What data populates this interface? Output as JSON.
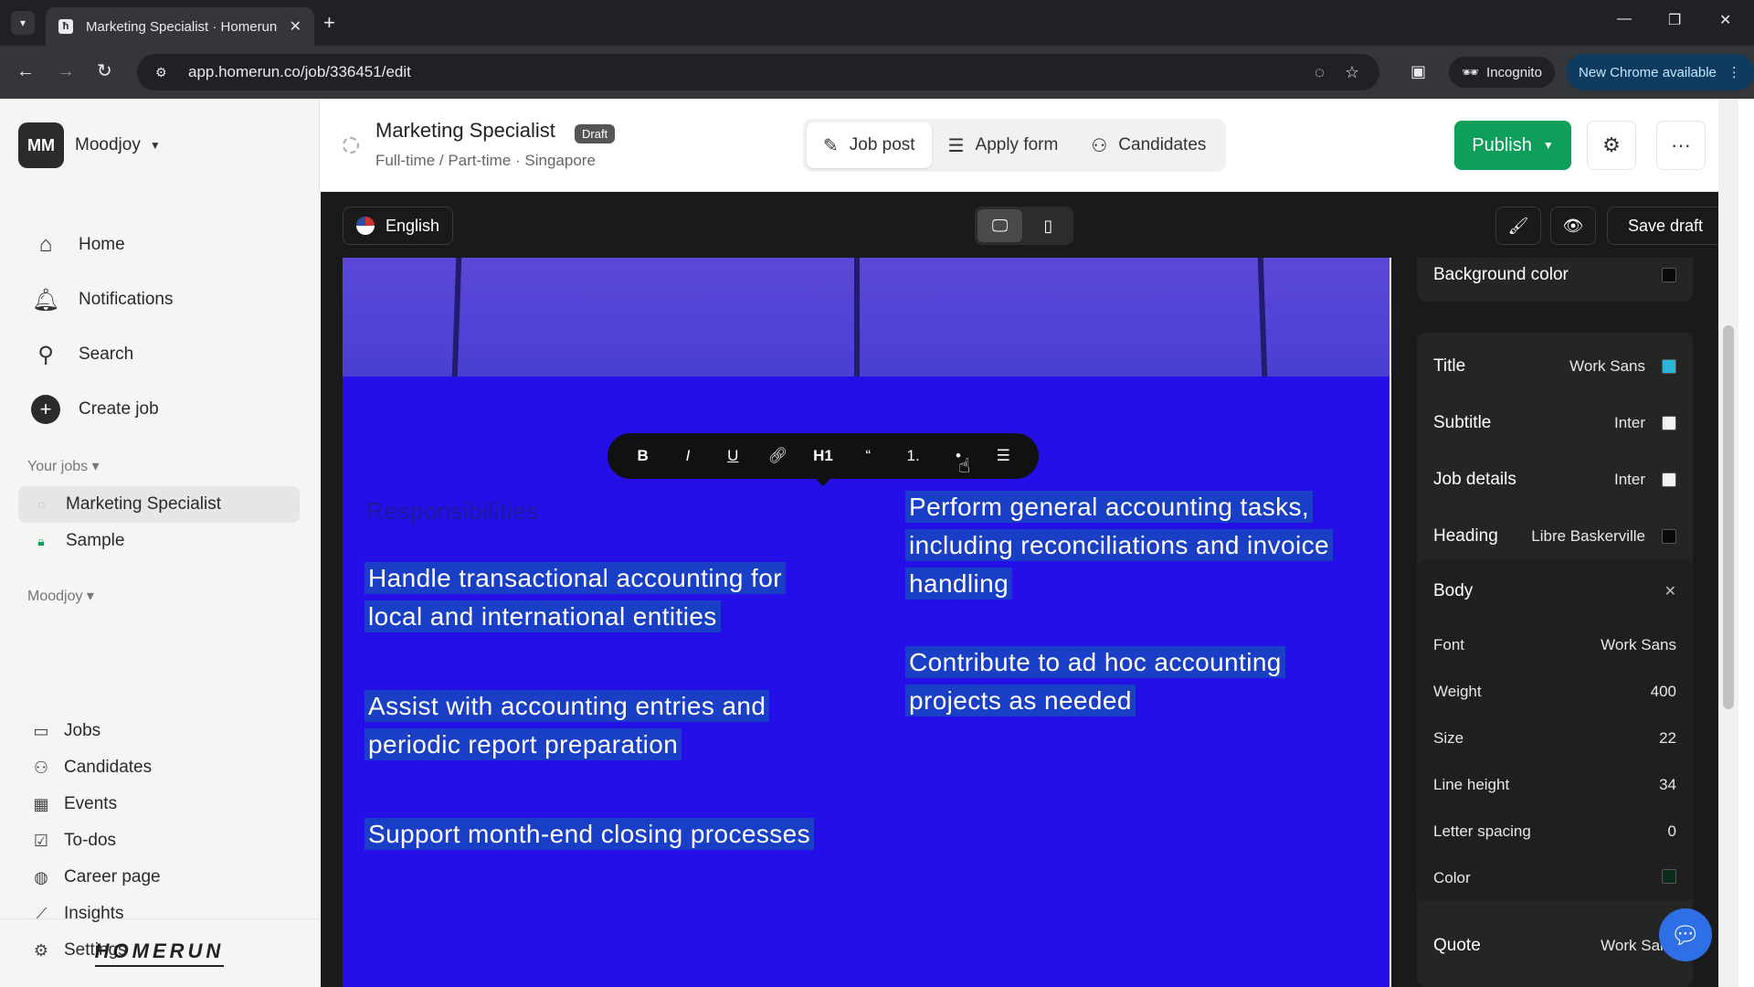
{
  "browser": {
    "tab_title": "Marketing Specialist · Homerun",
    "url": "app.homerun.co/job/336451/edit",
    "incognito_label": "Incognito",
    "new_chrome_label": "New Chrome available"
  },
  "sidebar": {
    "workspace": {
      "initials": "MM",
      "name": "Moodjoy"
    },
    "main_nav": [
      {
        "label": "Home",
        "icon": "home-icon"
      },
      {
        "label": "Notifications",
        "icon": "bell-icon"
      },
      {
        "label": "Search",
        "icon": "search-icon"
      },
      {
        "label": "Create job",
        "icon": "plus-icon"
      }
    ],
    "your_jobs_heading": "Your jobs",
    "jobs": [
      {
        "label": "Marketing Specialist",
        "icon": "draft-status-icon",
        "active": true
      },
      {
        "label": "Sample",
        "icon": "lock-icon",
        "active": false
      }
    ],
    "org_heading": "Moodjoy",
    "org_nav": [
      {
        "label": "Jobs",
        "icon": "jobs-icon"
      },
      {
        "label": "Candidates",
        "icon": "people-icon"
      },
      {
        "label": "Events",
        "icon": "calendar-icon"
      },
      {
        "label": "To-dos",
        "icon": "checkbox-icon"
      },
      {
        "label": "Career page",
        "icon": "globe-icon"
      },
      {
        "label": "Insights",
        "icon": "chart-icon"
      },
      {
        "label": "Settings",
        "icon": "gear-icon"
      }
    ],
    "logo": "HOMERUN"
  },
  "header": {
    "title": "Marketing Specialist",
    "badge": "Draft",
    "subtitle": "Full-time / Part-time · Singapore",
    "tabs": [
      {
        "label": "Job post",
        "icon": "pencil-icon",
        "active": true
      },
      {
        "label": "Apply form",
        "icon": "list-icon",
        "active": false
      },
      {
        "label": "Candidates",
        "icon": "people-icon",
        "active": false
      }
    ],
    "publish_label": "Publish"
  },
  "editor_bar": {
    "language": "English",
    "save_draft_label": "Save draft"
  },
  "format_toolbar": [
    "B",
    "I",
    "U",
    "link",
    "H1",
    "“",
    "1.",
    "•",
    "align"
  ],
  "content": {
    "heading": "Responsibilities",
    "left_items": [
      "Handle transactional accounting for local and international entities",
      "Assist with accounting entries and periodic report preparation",
      "Support month-end closing processes"
    ],
    "right_items": [
      "Perform general accounting tasks, including reconciliations and invoice handling",
      "Contribute to ad hoc accounting projects as needed"
    ]
  },
  "style_panel": {
    "background_color": {
      "label": "Background color",
      "color": "#0a0a0a"
    },
    "fonts": [
      {
        "label": "Title",
        "font": "Work Sans",
        "color": "#29b6d8"
      },
      {
        "label": "Subtitle",
        "font": "Inter",
        "color": "#f2f2f2"
      },
      {
        "label": "Job details",
        "font": "Inter",
        "color": "#f2f2f2"
      },
      {
        "label": "Heading",
        "font": "Libre Baskerville",
        "color": "#0a0a0a"
      }
    ],
    "body": {
      "label": "Body",
      "font_label": "Font",
      "font": "Work Sans",
      "weight_label": "Weight",
      "weight": "400",
      "size_label": "Size",
      "size": "22",
      "line_height_label": "Line height",
      "line_height": "34",
      "letter_spacing_label": "Letter spacing",
      "letter_spacing": "0",
      "color_label": "Color",
      "color": "#0d2b1a"
    },
    "quote": {
      "label": "Quote",
      "font": "Work Sans"
    }
  }
}
